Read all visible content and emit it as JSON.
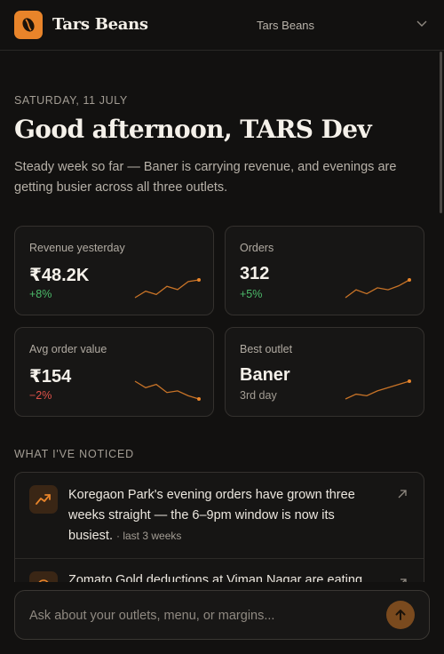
{
  "header": {
    "brand": "Tars Beans",
    "outlet_selector": {
      "selected": "Tars Beans"
    }
  },
  "greeting": {
    "date": "SATURDAY, 11 JULY",
    "title": "Good afternoon, TARS Dev",
    "summary": "Steady week so far — Baner is carrying revenue, and evenings are getting busier across all three outlets."
  },
  "kpis": [
    {
      "label": "Revenue yesterday",
      "value": "₹48.2K",
      "delta": "+8%",
      "trend": [
        2,
        6,
        4,
        9,
        7,
        12,
        13
      ]
    },
    {
      "label": "Orders",
      "value": "312",
      "delta": "+5%",
      "trend": [
        3,
        7,
        5,
        8,
        7,
        9,
        12
      ]
    },
    {
      "label": "Avg order value",
      "value": "₹154",
      "delta": "−2%",
      "trend": [
        11,
        7,
        9,
        4,
        5,
        2,
        0
      ]
    },
    {
      "label": "Best outlet",
      "value": "Baner",
      "delta": "3rd day",
      "trend": [
        1,
        4,
        3,
        6,
        8,
        10,
        12
      ]
    }
  ],
  "colors": {
    "accent": "#e8842a",
    "positive": "#4cbb6a",
    "negative": "#e0524a"
  },
  "insights": {
    "title": "WHAT I'VE NOTICED",
    "items": [
      {
        "icon": "trend-up-icon",
        "text": "Koregaon Park's evening orders have grown three weeks straight — the 6–9pm window is now its busiest.",
        "meta": "· last 3 weeks"
      },
      {
        "icon": "alert-icon",
        "text": "Zomato Gold deductions at Viman Nagar are eating",
        "meta": ""
      }
    ]
  },
  "composer": {
    "placeholder": "Ask about your outlets, menu, or margins..."
  }
}
